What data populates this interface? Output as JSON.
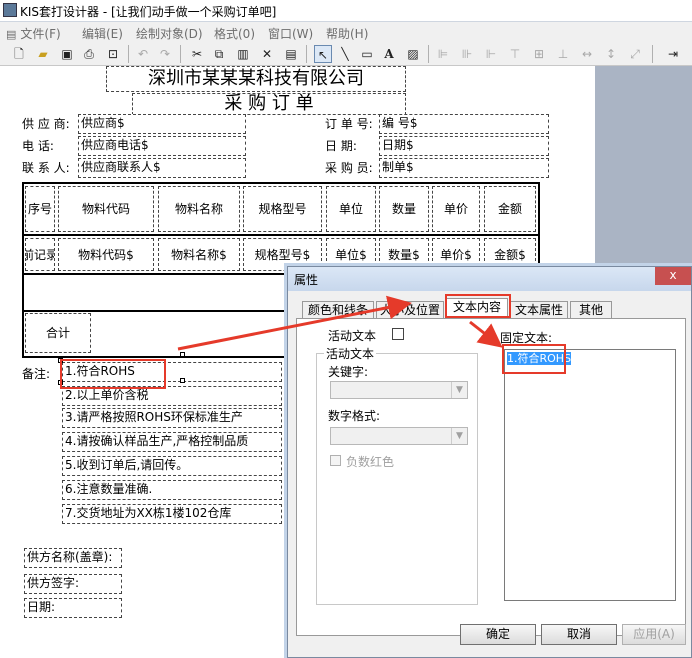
{
  "window": {
    "title": "KIS套打设计器 - [让我们动手做一个采购订单吧]"
  },
  "menu": [
    {
      "label": "文件(F)"
    },
    {
      "label": "编辑(E)"
    },
    {
      "label": "绘制对象(D)"
    },
    {
      "label": "格式(0)"
    },
    {
      "label": "窗口(W)"
    },
    {
      "label": "帮助(H)"
    }
  ],
  "toolbar": {
    "icons": [
      "new-icon",
      "open-icon",
      "save-icon",
      "print-icon",
      "print-preview-icon",
      "undo-icon",
      "redo-icon",
      "cut-icon",
      "copy-icon",
      "paste-icon",
      "delete-icon",
      "properties-icon",
      "select-arrow-icon",
      "line-icon",
      "rectangle-icon",
      "text-icon",
      "picture-icon",
      "align-left-icon",
      "align-center-icon",
      "align-right-icon",
      "align-top-icon",
      "align-middle-icon",
      "align-bottom-icon",
      "same-width-icon",
      "same-height-icon",
      "same-size-icon",
      "exit-icon"
    ],
    "text_tool": "A"
  },
  "doc": {
    "company": "深圳市某某某科技有限公司",
    "title": "采 购 订 单",
    "header_left": [
      {
        "label": "供 应 商:",
        "value": "供应商$"
      },
      {
        "label": "电    话:",
        "value": "供应商电话$"
      },
      {
        "label": "联 系 人:",
        "value": "供应商联系人$"
      }
    ],
    "header_right": [
      {
        "label": "订 单 号:",
        "value": "编    号$"
      },
      {
        "label": "日    期:",
        "value": "日期$"
      },
      {
        "label": "采 购 员:",
        "value": "制单$"
      }
    ],
    "table_headers": [
      "序号",
      "物料代码",
      "物料名称",
      "规格型号",
      "单位",
      "数量",
      "单价",
      "金额"
    ],
    "table_row": [
      "前记录",
      "物料代码$",
      "物料名称$",
      "规格型号$",
      "单位$",
      "数量$",
      "单价$",
      "金额$"
    ],
    "total_label": "合计",
    "notes_label": "备注:",
    "notes": [
      "1.符合ROHS",
      "2.以上单价含税",
      "3.请严格按照ROHS环保标准生产",
      "4.请按确认样品生产,严格控制品质",
      "5.收到订单后,请回传。",
      "6.注意数量准确.",
      "7.交货地址为XX栋1楼102仓库"
    ],
    "footer": [
      "供方名称(盖章):",
      "供方签字:",
      "日期:"
    ]
  },
  "dialog": {
    "title": "属性",
    "close": "x",
    "tabs": [
      "颜色和线条",
      "大小及位置",
      "文本内容",
      "文本属性",
      "其他"
    ],
    "active_tab": 2,
    "active_text_label": "活动文本",
    "active_text_group": "活动文本",
    "keyword_label": "关键字:",
    "number_format_label": "数字格式:",
    "negative_red_label": "负数红色",
    "fixed_text_label": "固定文本:",
    "fixed_text_value": "1.符合ROHS",
    "ok": "确定",
    "cancel": "取消",
    "apply": "应用(A)"
  },
  "colors": {
    "annotation": "#e53a2a",
    "selection": "#3399ff"
  }
}
